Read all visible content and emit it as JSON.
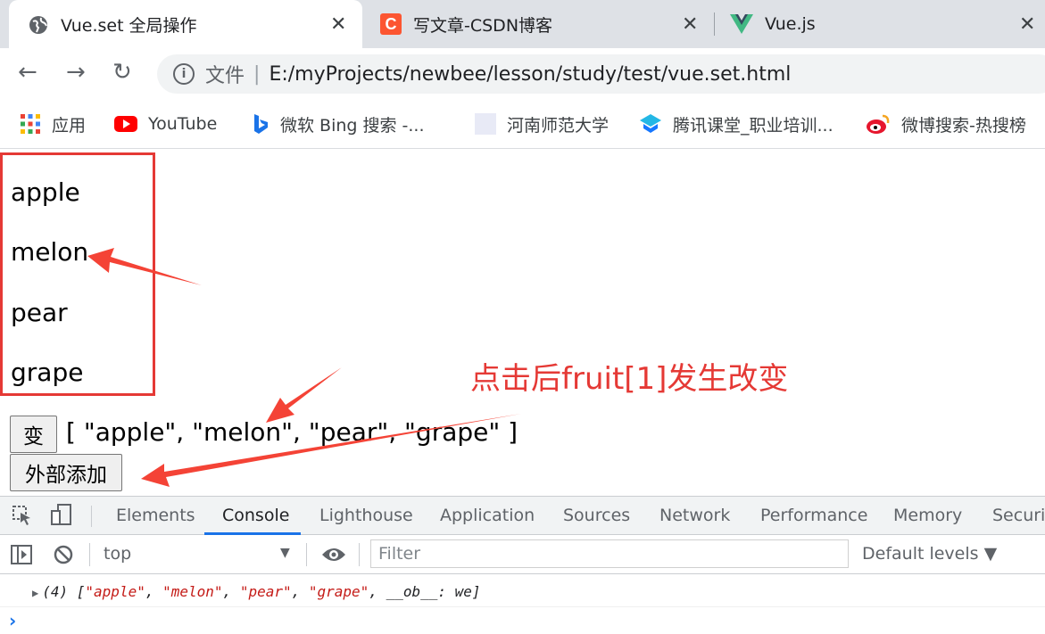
{
  "browser": {
    "tabs": [
      {
        "title": "Vue.set 全局操作",
        "icon": "globe-icon",
        "active": true
      },
      {
        "title": "写文章-CSDN博客",
        "icon": "csdn-icon",
        "active": false
      },
      {
        "title": "Vue.js",
        "icon": "vue-icon",
        "active": false
      }
    ],
    "close_glyph": "✕",
    "address": {
      "file_label": "文件",
      "separator": "|",
      "url": "E:/myProjects/newbee/lesson/study/test/vue.set.html"
    },
    "bookmarks": [
      {
        "label": "应用",
        "icon": "apps-grid-icon"
      },
      {
        "label": "YouTube",
        "icon": "youtube-icon"
      },
      {
        "label": "微软 Bing 搜索 -...",
        "icon": "bing-icon"
      },
      {
        "label": "河南师范大学",
        "icon": "page-icon"
      },
      {
        "label": "腾讯课堂_职业培训...",
        "icon": "tencent-classroom-icon"
      },
      {
        "label": "微博搜索-热搜榜",
        "icon": "weibo-icon"
      }
    ]
  },
  "page": {
    "fruits": [
      "apple",
      "melon",
      "pear",
      "grape"
    ],
    "change_button": "变",
    "array_display": "[ \"apple\", \"melon\", \"pear\", \"grape\" ]",
    "external_add_button": "外部添加",
    "annotation": "点击后fruit[1]发生改变",
    "annotation_color": "#e53935"
  },
  "devtools": {
    "tabs": [
      "Elements",
      "Console",
      "Lighthouse",
      "Application",
      "Sources",
      "Network",
      "Performance",
      "Memory",
      "Securit"
    ],
    "active_tab": "Console",
    "context": "top",
    "filter_placeholder": "Filter",
    "levels": "Default levels ▼",
    "log": {
      "prefix": "(4) [",
      "items": [
        "\"apple\"",
        "\"melon\"",
        "\"pear\"",
        "\"grape\""
      ],
      "suffix": "__ob__: we]"
    },
    "prompt": "›"
  }
}
